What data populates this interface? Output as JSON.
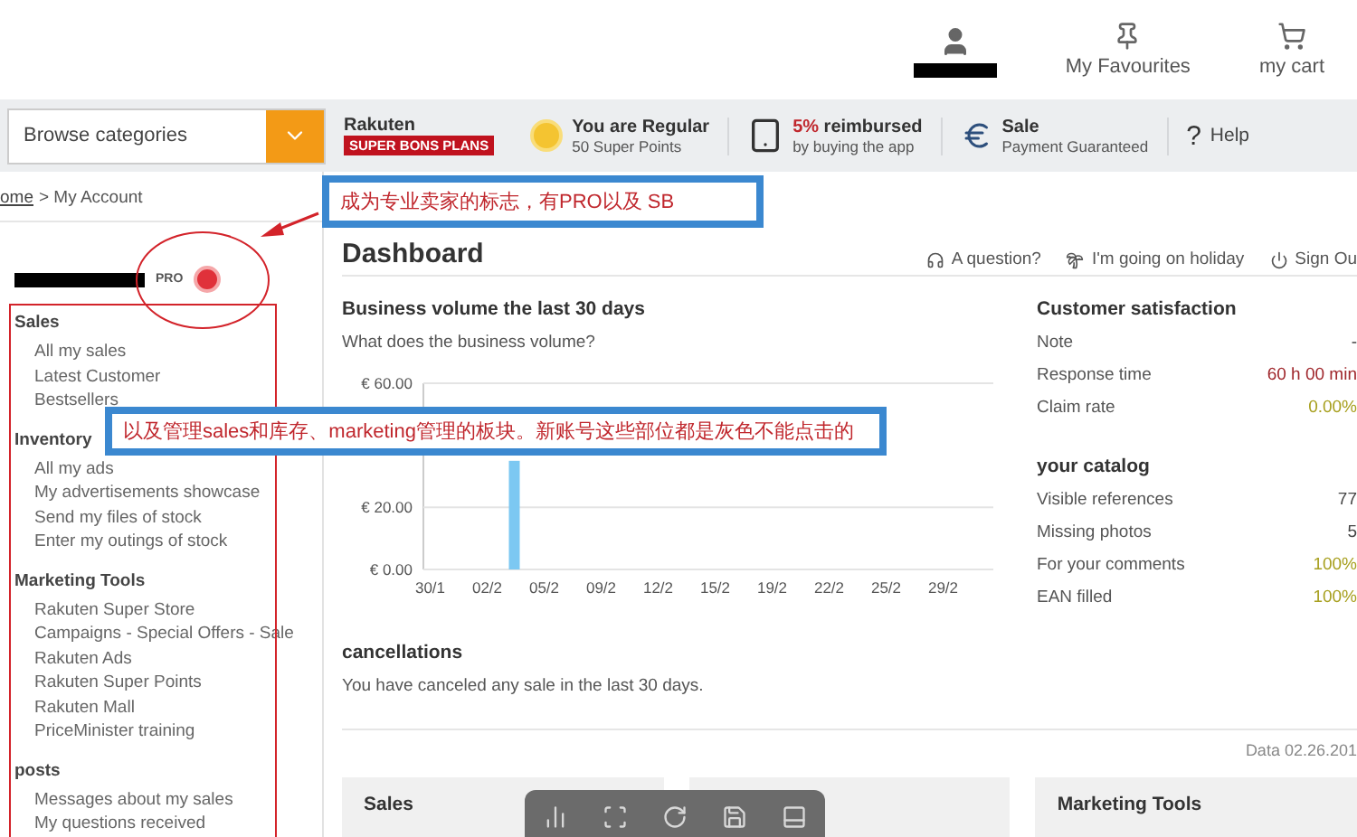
{
  "header": {
    "links": [
      {
        "kind": "favourites",
        "label": "My Favourites"
      },
      {
        "kind": "cart",
        "label": "my cart"
      }
    ]
  },
  "nav": {
    "browse": {
      "value": "Browse categories"
    },
    "promos": [
      {
        "kind": "logo",
        "title": "Rakuten",
        "subtitle": "SUPER BONS PLANS"
      },
      {
        "kind": "coin",
        "title": "You are Regular",
        "subtitle": "50 Super Points"
      },
      {
        "kind": "tablet",
        "highlight": "5%",
        "title": "reimbursed",
        "subtitle": "by buying the app"
      },
      {
        "kind": "euro",
        "title": "Sale",
        "subtitle": "Payment Guaranteed"
      },
      {
        "kind": "help",
        "glyph": "?",
        "title": "Help"
      }
    ]
  },
  "breadcrumb": {
    "link": "ome",
    "current": "> My Account"
  },
  "seller": {
    "badge": "PRO"
  },
  "sidebar": [
    {
      "title": "Sales",
      "items": [
        "All my sales",
        "Latest Customer",
        "Bestsellers"
      ]
    },
    {
      "title": "Inventory",
      "items": [
        "All my ads",
        "My advertisements showcase",
        "Send my files of stock",
        "Enter my outings of stock"
      ]
    },
    {
      "title": "Marketing Tools",
      "items": [
        "Rakuten Super Store",
        "Campaigns - Special Offers - Sale",
        "Rakuten Ads",
        "Rakuten Super Points",
        "Rakuten Mall",
        "PriceMinister training"
      ]
    },
    {
      "title": "posts",
      "items": [
        "Messages about my sales",
        "My questions received"
      ]
    }
  ],
  "dashboard": {
    "title": "Dashboard",
    "actions": [
      {
        "kind": "question",
        "label": "A question?"
      },
      {
        "kind": "holiday",
        "label": "I'm going on holiday"
      },
      {
        "kind": "signout",
        "label": "Sign Ou"
      }
    ]
  },
  "business": {
    "title": "Business volume the last 30 days",
    "subtitle": "What does the business volume?",
    "chart_data": {
      "type": "bar",
      "categories": [
        "30/1",
        "02/2",
        "05/2",
        "09/2",
        "12/2",
        "15/2",
        "19/2",
        "22/2",
        "25/2",
        "29/2"
      ],
      "values": [
        0,
        35,
        0,
        0,
        0,
        0,
        0,
        0,
        0,
        0
      ],
      "ylim": [
        0,
        60
      ],
      "yticks": [
        {
          "value": 0,
          "label": "€ 0.00"
        },
        {
          "value": 20,
          "label": "€ 20.00"
        },
        {
          "value": 60,
          "label": "€ 60.00"
        }
      ]
    }
  },
  "cancellations": {
    "title": "cancellations",
    "text": "You have canceled any sale in the last 30 days."
  },
  "satisfaction": {
    "title": "Customer satisfaction",
    "rows": [
      {
        "label": "Note",
        "value": "-"
      },
      {
        "label": "Response time",
        "value": "60 h 00 min",
        "color": "#a0282d"
      },
      {
        "label": "Claim rate",
        "value": "0.00%",
        "color": "#a8a020"
      }
    ]
  },
  "catalog": {
    "title": "your catalog",
    "rows": [
      {
        "label": "Visible references",
        "value": "77"
      },
      {
        "label": "Missing photos",
        "value": "5"
      },
      {
        "label": "For your comments",
        "value": "100%",
        "color": "#a8a020"
      },
      {
        "label": "EAN filled",
        "value": "100%",
        "color": "#a8a020"
      }
    ]
  },
  "date": "Data 02.26.201",
  "cards": [
    {
      "kind": "titled",
      "title": "Sales"
    },
    {
      "kind": "covered"
    },
    {
      "kind": "titled",
      "title": "Marketing Tools"
    }
  ],
  "annotations": [
    {
      "kind": "note",
      "text": "成为专业卖家的标志，有PRO以及 SB"
    },
    {
      "kind": "note",
      "text": "以及管理sales和库存、marketing管理的板块。新账号这些部位都是灰色不能点击的"
    }
  ]
}
